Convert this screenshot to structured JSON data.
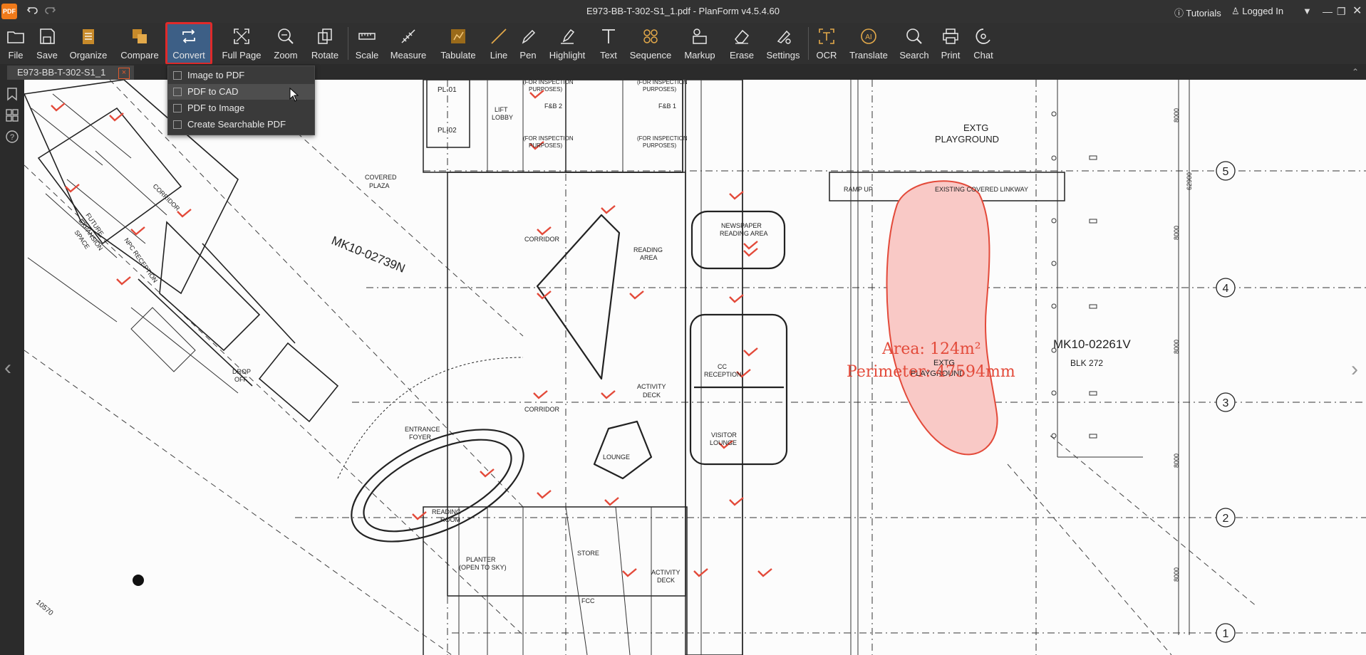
{
  "app": {
    "logo_text": "PDF",
    "window_title": "E973-BB-T-302-S1_1.pdf - PlanForm v4.5.4.60",
    "tutorials": "Tutorials",
    "login": "Logged In"
  },
  "toolbar": {
    "file": "File",
    "save": "Save",
    "organize": "Organize",
    "compare": "Compare",
    "convert": "Convert",
    "full_page": "Full Page",
    "zoom": "Zoom",
    "rotate": "Rotate",
    "scale": "Scale",
    "measure": "Measure",
    "tabulate": "Tabulate",
    "line": "Line",
    "pen": "Pen",
    "highlight": "Highlight",
    "text": "Text",
    "sequence": "Sequence",
    "markup": "Markup",
    "erase": "Erase",
    "settings": "Settings",
    "ocr": "OCR",
    "translate": "Translate",
    "search": "Search",
    "print": "Print",
    "chat": "Chat"
  },
  "tab": {
    "name": "E973-BB-T-302-S1_1",
    "close": "×"
  },
  "convert_menu": {
    "items": [
      "Image to PDF",
      "PDF to CAD",
      "PDF to Image",
      "Create Searchable PDF"
    ],
    "hovered": "PDF to CAD"
  },
  "drawing": {
    "labels": {
      "pl01": "PL-01",
      "pl02": "PL-02",
      "lift_lobby": "LIFT",
      "lift_lobby2": "LOBBY",
      "for_insp1": "(FOR INSPECTION",
      "purposes": "PURPOSES)",
      "fb2": "F&B 2",
      "fb1": "F&B 1",
      "extg": "EXTG",
      "playground": "PLAYGROUND",
      "covered": "COVERED",
      "plaza": "PLAZA",
      "mk10a": "MK10-02739N",
      "mk10b": "MK10-02261V",
      "blk": "BLK 272",
      "ramp_up": "RAMP UP",
      "linkway": "EXISTING COVERED LINKWAY",
      "newspaper": "NEWSPAPER",
      "reading_area": "READING AREA",
      "reading": "READING",
      "area": "AREA",
      "corridor": "CORRIDOR",
      "cc_reception": "CC",
      "reception": "RECEPTION",
      "activity": "ACTIVITY",
      "deck": "DECK",
      "visitor": "VISITOR",
      "lounge": "LOUNGE",
      "lounge2": "LOUNGE",
      "reading_room": "READING",
      "room": "ROOM",
      "entrance": "ENTRANCE",
      "foyer": "FOYER",
      "drop": "DROP",
      "off": "OFF",
      "planter": "PLANTER",
      "open_sky": "(OPEN TO SKY)",
      "store": "STORE",
      "fcc": "FCC",
      "activity2": "ACTIVITY",
      "deck2": "DECK",
      "future": "FUTURE",
      "expansion": "EXPANSION",
      "space": "SPACE",
      "npc": "NPC RECEPTION",
      "corridor2": "CORRIDOR",
      "extg2": "EXTG",
      "playground2": "PLAYGROUND",
      "num10570": "10570",
      "dim8000": "8000",
      "dim62900": "62900",
      "grid5": "5",
      "grid4": "4",
      "grid3": "3",
      "grid2": "2",
      "grid1": "1"
    },
    "measurement": {
      "area": "Area: 124m²",
      "perimeter": "Perimeter: 47594mm"
    }
  },
  "colors": {
    "accent": "#e02a2a",
    "convert_bg": "#3d5f86",
    "measure_red": "#e34a3a",
    "area_fill": "#f9c9c6"
  }
}
